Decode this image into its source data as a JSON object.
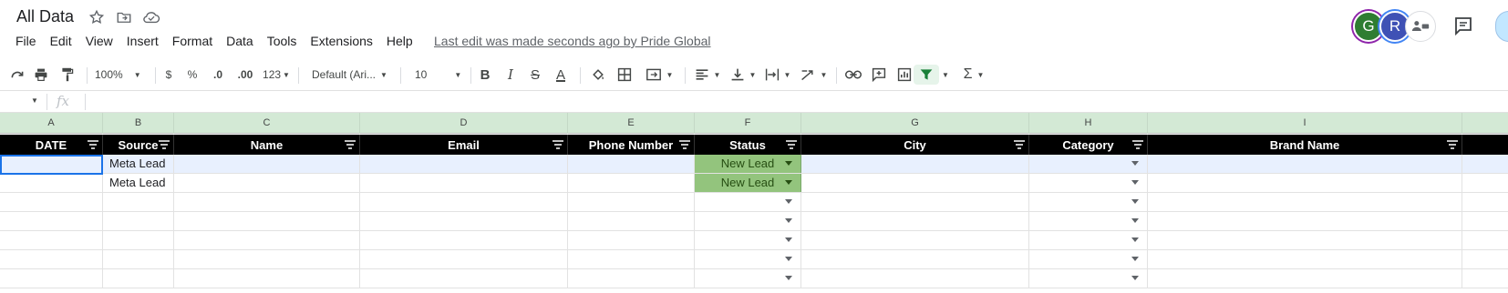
{
  "app": {
    "title": "All Data",
    "last_edit": "Last edit was made seconds ago by Pride Global"
  },
  "menu": [
    "File",
    "Edit",
    "View",
    "Insert",
    "Format",
    "Data",
    "Tools",
    "Extensions",
    "Help"
  ],
  "avatars": [
    "G",
    "R"
  ],
  "toolbar": {
    "zoom": "100%",
    "currency": "$",
    "percent": "%",
    "dec_decrease": ".0",
    "dec_increase": ".00",
    "more_formats": "123",
    "font": "Default (Ari...",
    "font_size": "10",
    "bold": "B",
    "italic": "I",
    "strike": "S",
    "text_color": "A",
    "function": "Σ"
  },
  "formula_bar": {
    "fx": "fx"
  },
  "grid": {
    "column_letters": [
      "A",
      "B",
      "C",
      "D",
      "E",
      "F",
      "G",
      "H",
      "I"
    ],
    "headers": [
      "DATE",
      "Source",
      "Name",
      "Email",
      "Phone Number",
      "Status",
      "City",
      "Category",
      "Brand Name"
    ],
    "rows": [
      [
        "",
        "Meta Lead",
        "",
        "",
        "",
        "New Lead",
        "",
        "",
        ""
      ],
      [
        "",
        "Meta Lead",
        "",
        "",
        "",
        "New Lead",
        "",
        "",
        ""
      ],
      [
        "",
        "",
        "",
        "",
        "",
        "",
        "",
        "",
        ""
      ],
      [
        "",
        "",
        "",
        "",
        "",
        "",
        "",
        "",
        ""
      ],
      [
        "",
        "",
        "",
        "",
        "",
        "",
        "",
        "",
        ""
      ],
      [
        "",
        "",
        "",
        "",
        "",
        "",
        "",
        "",
        ""
      ],
      [
        "",
        "",
        "",
        "",
        "",
        "",
        "",
        "",
        ""
      ]
    ]
  },
  "colors": {
    "status_chip": "#93c47d",
    "header_bg": "#000000",
    "column_letter_bg": "#d3e9d5",
    "selection": "#1a73e8"
  }
}
